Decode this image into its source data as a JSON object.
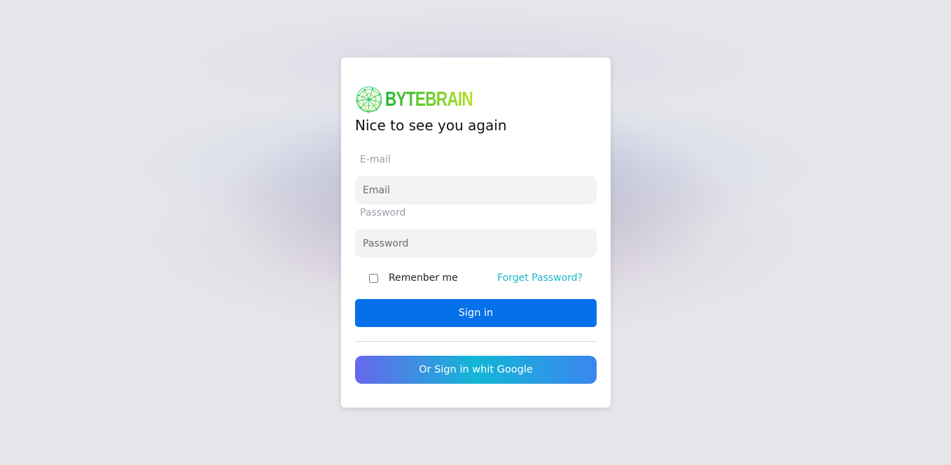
{
  "brand": {
    "name": "BYTEBRAIN",
    "logo_icon": "brain-network-icon",
    "gradient": [
      "#21b833",
      "#b7e02a"
    ]
  },
  "login": {
    "heading": "Nice to see you again",
    "email_label": "E-mail",
    "email_placeholder": "Email",
    "email_value": "",
    "password_label": "Password",
    "password_placeholder": "Password",
    "password_value": "",
    "remember_label": "Remenber me",
    "remember_checked": false,
    "forgot_link": "Forget Password?",
    "signin_button": "Sign in",
    "google_button": "Or Sign in whit Google"
  },
  "colors": {
    "primary": "#0670ea",
    "link": "#19b6c9",
    "google_gradient": [
      "#6767ec",
      "#13b6d6",
      "#3a86f0"
    ],
    "page_background": "#e5e6ea"
  }
}
